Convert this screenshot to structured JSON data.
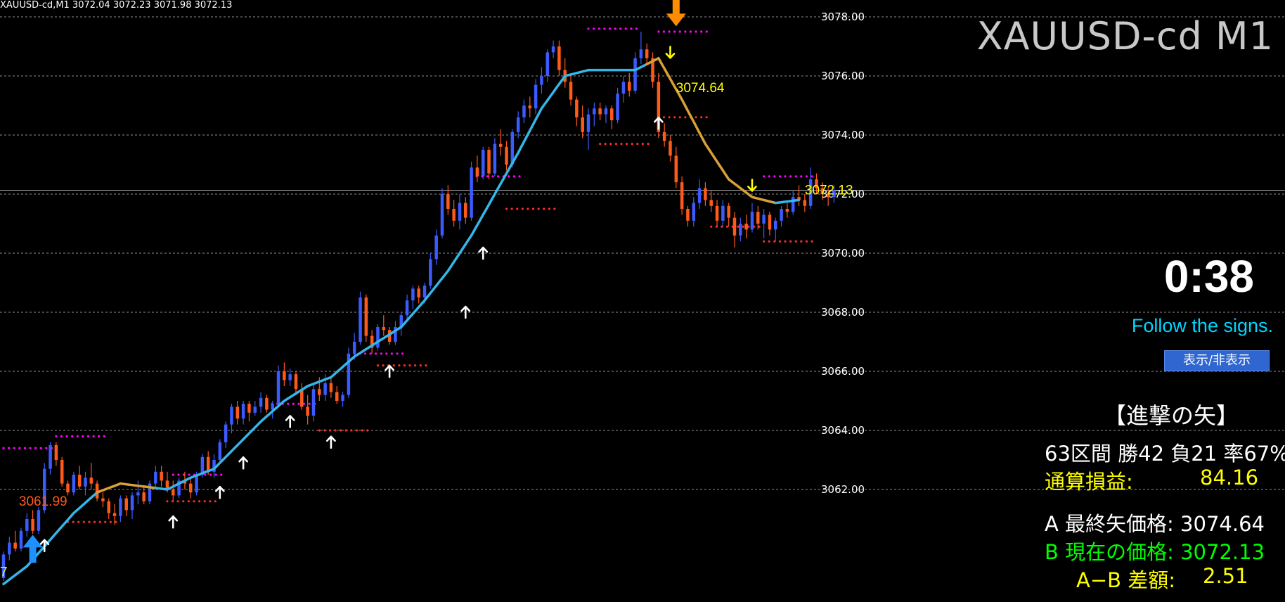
{
  "header": {
    "info": "XAUUSD-cd,M1  3072.04 3072.23 3071.98 3072.13",
    "symbol_title": "XAUUSD-cd M1"
  },
  "panel": {
    "timer": "0:38",
    "tagline": "Follow the signs.",
    "toggle_label": "表示/非表示",
    "title": "【進撃の矢】",
    "summary": "63区間 勝42 負21 率67%",
    "total_pl_label": "通算損益:",
    "total_pl_value": "84.16",
    "last_arrow": "A 最終矢価格: 3074.64",
    "current_price": "B 現在の価格: 3072.13",
    "diff_label": "A−B 差額:",
    "diff_value": "2.51"
  },
  "chart_data": {
    "type": "candlestick",
    "symbol": "XAUUSD-cd",
    "timeframe": "M1",
    "ylim": [
      3058.7,
      3079.2
    ],
    "y_ticks": [
      "3078.00",
      "3076.00",
      "3074.00",
      "3072.00",
      "3070.00",
      "3068.00",
      "3066.00",
      "3064.00",
      "3062.00"
    ],
    "grid": true,
    "colors": {
      "up": "#3b5bff",
      "down": "#ff5a1a",
      "trend_up": "#35b6e8",
      "trend_down": "#d9a036",
      "resistance": "#ff00ff",
      "support": "#ff2a2a",
      "price_label": "#ffff00",
      "grid": "#bfbfbf"
    },
    "candles": [
      [
        3059.0,
        3059.9,
        3058.9,
        3059.8
      ],
      [
        3059.8,
        3060.4,
        3059.6,
        3060.2
      ],
      [
        3060.2,
        3060.6,
        3059.9,
        3060.0
      ],
      [
        3060.0,
        3060.7,
        3059.9,
        3060.6
      ],
      [
        3060.6,
        3061.2,
        3060.4,
        3061.0
      ],
      [
        3061.0,
        3061.3,
        3060.5,
        3060.6
      ],
      [
        3060.6,
        3061.4,
        3060.5,
        3061.3
      ],
      [
        3061.3,
        3062.9,
        3061.2,
        3062.7
      ],
      [
        3062.7,
        3063.6,
        3062.5,
        3063.5
      ],
      [
        3063.5,
        3063.6,
        3062.8,
        3063.0
      ],
      [
        3063.0,
        3063.1,
        3062.1,
        3062.2
      ],
      [
        3062.2,
        3062.3,
        3061.8,
        3061.9
      ],
      [
        3061.9,
        3062.6,
        3061.8,
        3062.5
      ],
      [
        3062.5,
        3062.8,
        3062.0,
        3062.1
      ],
      [
        3062.1,
        3062.6,
        3061.8,
        3062.4
      ],
      [
        3062.4,
        3062.9,
        3062.0,
        3062.2
      ],
      [
        3062.2,
        3062.3,
        3061.6,
        3061.7
      ],
      [
        3061.7,
        3061.9,
        3061.4,
        3061.6
      ],
      [
        3061.6,
        3061.7,
        3061.0,
        3061.2
      ],
      [
        3061.2,
        3061.5,
        3060.8,
        3061.1
      ],
      [
        3061.1,
        3061.8,
        3060.9,
        3061.7
      ],
      [
        3061.7,
        3061.8,
        3061.1,
        3061.3
      ],
      [
        3061.3,
        3061.9,
        3061.0,
        3061.8
      ],
      [
        3061.8,
        3062.3,
        3061.5,
        3061.9
      ],
      [
        3061.9,
        3062.1,
        3061.5,
        3061.6
      ],
      [
        3061.6,
        3062.3,
        3061.5,
        3062.2
      ],
      [
        3062.2,
        3062.8,
        3062.0,
        3062.6
      ],
      [
        3062.6,
        3062.8,
        3062.1,
        3062.3
      ],
      [
        3062.3,
        3062.6,
        3061.9,
        3062.0
      ],
      [
        3062.0,
        3062.3,
        3061.6,
        3061.8
      ],
      [
        3061.8,
        3062.4,
        3061.7,
        3062.3
      ],
      [
        3062.3,
        3062.6,
        3062.0,
        3062.2
      ],
      [
        3062.2,
        3062.4,
        3061.7,
        3061.9
      ],
      [
        3061.9,
        3062.6,
        3061.8,
        3062.5
      ],
      [
        3062.5,
        3063.2,
        3062.4,
        3063.1
      ],
      [
        3063.1,
        3063.3,
        3062.5,
        3062.6
      ],
      [
        3062.6,
        3063.2,
        3062.4,
        3063.0
      ],
      [
        3063.0,
        3063.7,
        3062.9,
        3063.6
      ],
      [
        3063.6,
        3064.3,
        3063.4,
        3064.2
      ],
      [
        3064.2,
        3064.9,
        3063.9,
        3064.8
      ],
      [
        3064.8,
        3065.0,
        3064.2,
        3064.4
      ],
      [
        3064.4,
        3065.0,
        3064.2,
        3064.9
      ],
      [
        3064.9,
        3065.0,
        3064.3,
        3064.6
      ],
      [
        3064.6,
        3065.0,
        3064.5,
        3064.8
      ],
      [
        3064.8,
        3065.3,
        3064.6,
        3065.1
      ],
      [
        3065.1,
        3065.2,
        3064.6,
        3064.7
      ],
      [
        3064.7,
        3065.0,
        3064.4,
        3064.9
      ],
      [
        3064.9,
        3066.2,
        3064.8,
        3066.0
      ],
      [
        3066.0,
        3066.3,
        3065.5,
        3065.7
      ],
      [
        3065.7,
        3066.1,
        3065.5,
        3065.9
      ],
      [
        3065.9,
        3066.0,
        3065.2,
        3065.4
      ],
      [
        3065.4,
        3065.6,
        3064.7,
        3064.8
      ],
      [
        3064.8,
        3065.2,
        3064.2,
        3064.5
      ],
      [
        3064.5,
        3065.6,
        3064.3,
        3065.4
      ],
      [
        3065.4,
        3065.8,
        3065.0,
        3065.2
      ],
      [
        3065.2,
        3065.9,
        3065.0,
        3065.6
      ],
      [
        3065.6,
        3065.8,
        3065.1,
        3065.3
      ],
      [
        3065.3,
        3065.5,
        3064.9,
        3065.0
      ],
      [
        3065.0,
        3065.3,
        3064.8,
        3065.2
      ],
      [
        3065.2,
        3066.8,
        3065.1,
        3066.6
      ],
      [
        3066.6,
        3067.3,
        3066.4,
        3067.0
      ],
      [
        3067.0,
        3068.7,
        3066.9,
        3068.5
      ],
      [
        3068.5,
        3068.6,
        3067.0,
        3067.2
      ],
      [
        3067.2,
        3067.4,
        3066.6,
        3066.8
      ],
      [
        3066.8,
        3067.6,
        3066.7,
        3067.5
      ],
      [
        3067.5,
        3067.9,
        3067.2,
        3067.4
      ],
      [
        3067.4,
        3067.5,
        3066.9,
        3067.0
      ],
      [
        3067.0,
        3067.7,
        3066.9,
        3067.5
      ],
      [
        3067.5,
        3068.0,
        3067.2,
        3067.9
      ],
      [
        3067.9,
        3068.6,
        3067.7,
        3068.4
      ],
      [
        3068.4,
        3068.9,
        3068.1,
        3068.8
      ],
      [
        3068.8,
        3068.9,
        3068.3,
        3068.5
      ],
      [
        3068.5,
        3069.0,
        3068.3,
        3068.9
      ],
      [
        3068.9,
        3070.0,
        3068.8,
        3069.8
      ],
      [
        3069.8,
        3070.8,
        3069.6,
        3070.6
      ],
      [
        3070.6,
        3072.2,
        3070.5,
        3072.0
      ],
      [
        3072.0,
        3072.3,
        3071.3,
        3071.5
      ],
      [
        3071.5,
        3071.8,
        3070.9,
        3071.1
      ],
      [
        3071.1,
        3072.0,
        3070.8,
        3071.7
      ],
      [
        3071.7,
        3071.9,
        3071.0,
        3071.2
      ],
      [
        3071.2,
        3073.1,
        3071.1,
        3072.9
      ],
      [
        3072.9,
        3073.3,
        3072.4,
        3072.6
      ],
      [
        3072.6,
        3073.6,
        3072.5,
        3073.5
      ],
      [
        3073.5,
        3073.6,
        3072.5,
        3072.7
      ],
      [
        3072.7,
        3073.9,
        3072.6,
        3073.7
      ],
      [
        3073.7,
        3074.2,
        3073.3,
        3073.6
      ],
      [
        3073.6,
        3073.8,
        3072.8,
        3073.0
      ],
      [
        3073.0,
        3074.2,
        3072.9,
        3074.1
      ],
      [
        3074.1,
        3074.8,
        3073.9,
        3074.6
      ],
      [
        3074.6,
        3075.2,
        3074.4,
        3075.0
      ],
      [
        3075.0,
        3075.3,
        3074.6,
        3074.9
      ],
      [
        3074.9,
        3075.9,
        3074.7,
        3075.7
      ],
      [
        3075.7,
        3076.3,
        3075.4,
        3076.0
      ],
      [
        3076.0,
        3076.9,
        3075.8,
        3076.8
      ],
      [
        3076.8,
        3077.2,
        3076.6,
        3077.0
      ],
      [
        3077.0,
        3077.2,
        3076.0,
        3076.2
      ],
      [
        3076.2,
        3076.6,
        3075.6,
        3075.8
      ],
      [
        3075.8,
        3076.0,
        3075.0,
        3075.2
      ],
      [
        3075.2,
        3075.3,
        3074.3,
        3074.6
      ],
      [
        3074.6,
        3075.0,
        3073.9,
        3074.1
      ],
      [
        3074.1,
        3074.9,
        3073.5,
        3074.7
      ],
      [
        3074.7,
        3075.1,
        3074.3,
        3074.9
      ],
      [
        3074.9,
        3075.1,
        3074.5,
        3074.7
      ],
      [
        3074.7,
        3075.0,
        3074.4,
        3074.9
      ],
      [
        3074.9,
        3075.0,
        3074.2,
        3074.5
      ],
      [
        3074.5,
        3075.6,
        3074.4,
        3075.4
      ],
      [
        3075.4,
        3076.0,
        3075.1,
        3075.8
      ],
      [
        3075.8,
        3076.1,
        3075.3,
        3075.5
      ],
      [
        3075.5,
        3076.8,
        3075.4,
        3076.6
      ],
      [
        3076.6,
        3077.5,
        3076.4,
        3076.9
      ],
      [
        3076.9,
        3077.1,
        3076.4,
        3076.6
      ],
      [
        3076.6,
        3076.8,
        3075.6,
        3075.8
      ],
      [
        3075.8,
        3076.1,
        3073.9,
        3074.1
      ],
      [
        3074.1,
        3074.4,
        3073.6,
        3073.8
      ],
      [
        3073.8,
        3074.0,
        3073.1,
        3073.3
      ],
      [
        3073.3,
        3073.6,
        3072.2,
        3072.4
      ],
      [
        3072.4,
        3072.6,
        3071.3,
        3071.5
      ],
      [
        3071.5,
        3071.6,
        3070.9,
        3071.1
      ],
      [
        3071.1,
        3071.9,
        3070.9,
        3071.7
      ],
      [
        3071.7,
        3072.5,
        3071.5,
        3072.2
      ],
      [
        3072.2,
        3072.4,
        3071.6,
        3071.8
      ],
      [
        3071.8,
        3072.1,
        3071.4,
        3071.6
      ],
      [
        3071.6,
        3071.8,
        3070.9,
        3071.1
      ],
      [
        3071.1,
        3071.8,
        3070.9,
        3071.6
      ],
      [
        3071.6,
        3071.7,
        3070.9,
        3071.2
      ],
      [
        3071.2,
        3071.4,
        3070.2,
        3070.6
      ],
      [
        3070.6,
        3071.2,
        3070.4,
        3071.0
      ],
      [
        3071.0,
        3071.3,
        3070.5,
        3070.8
      ],
      [
        3070.8,
        3071.7,
        3070.7,
        3071.4
      ],
      [
        3071.4,
        3071.6,
        3070.8,
        3071.0
      ],
      [
        3071.0,
        3071.5,
        3070.5,
        3071.3
      ],
      [
        3071.3,
        3071.4,
        3070.6,
        3070.8
      ],
      [
        3070.8,
        3071.2,
        3070.4,
        3071.1
      ],
      [
        3071.1,
        3071.6,
        3070.9,
        3071.5
      ],
      [
        3071.5,
        3071.7,
        3071.2,
        3071.4
      ],
      [
        3071.4,
        3072.1,
        3071.3,
        3071.9
      ],
      [
        3071.9,
        3072.3,
        3071.6,
        3071.8
      ],
      [
        3071.8,
        3072.0,
        3071.4,
        3071.6
      ],
      [
        3071.6,
        3072.9,
        3071.5,
        3072.5
      ],
      [
        3072.5,
        3072.7,
        3072.0,
        3072.2
      ],
      [
        3072.2,
        3072.4,
        3071.8,
        3072.0
      ],
      [
        3072.0,
        3072.2,
        3071.6,
        3071.9
      ],
      [
        3071.9,
        3072.3,
        3071.7,
        3072.13
      ]
    ],
    "trend_line": [
      [
        0,
        3058.8
      ],
      [
        4,
        3059.4
      ],
      [
        8,
        3060.3
      ],
      [
        12,
        3061.2
      ],
      [
        16,
        3061.9
      ],
      [
        20,
        3062.2
      ],
      [
        24,
        3062.1
      ],
      [
        28,
        3062.0
      ],
      [
        32,
        3062.4
      ],
      [
        36,
        3062.7
      ],
      [
        40,
        3063.5
      ],
      [
        44,
        3064.3
      ],
      [
        48,
        3065.0
      ],
      [
        52,
        3065.5
      ],
      [
        56,
        3065.8
      ],
      [
        60,
        3066.5
      ],
      [
        64,
        3067.0
      ],
      [
        68,
        3067.5
      ],
      [
        72,
        3068.4
      ],
      [
        76,
        3069.4
      ],
      [
        80,
        3070.6
      ],
      [
        84,
        3072.0
      ],
      [
        88,
        3073.4
      ],
      [
        92,
        3074.9
      ],
      [
        96,
        3076.0
      ],
      [
        100,
        3076.2
      ],
      [
        104,
        3076.2
      ],
      [
        108,
        3076.2
      ],
      [
        112,
        3076.6
      ],
      [
        116,
        3075.2
      ],
      [
        120,
        3073.7
      ],
      [
        124,
        3072.5
      ],
      [
        128,
        3071.9
      ],
      [
        132,
        3071.7
      ],
      [
        136,
        3071.8
      ]
    ],
    "trend_direction": [
      [
        0,
        16,
        "up"
      ],
      [
        16,
        26,
        "down"
      ],
      [
        26,
        110,
        "up"
      ],
      [
        110,
        132,
        "down"
      ],
      [
        132,
        136,
        "up"
      ]
    ],
    "resistance_dotted": [
      [
        0,
        3063.4
      ],
      [
        9,
        3063.8
      ],
      [
        29,
        3062.5
      ],
      [
        45,
        3064.9
      ],
      [
        60,
        3066.6
      ],
      [
        80,
        3072.6
      ],
      [
        100,
        3077.6
      ],
      [
        112,
        3077.5
      ],
      [
        130,
        3072.6
      ]
    ],
    "support_dotted": [
      [
        11,
        3060.9
      ],
      [
        28,
        3061.6
      ],
      [
        54,
        3064.0
      ],
      [
        64,
        3066.2
      ],
      [
        86,
        3071.5
      ],
      [
        102,
        3073.7
      ],
      [
        112,
        3074.6
      ],
      [
        121,
        3070.9
      ],
      [
        130,
        3070.4
      ]
    ],
    "up_arrows": [
      [
        7,
        3060.1
      ],
      [
        29,
        3060.9
      ],
      [
        37,
        3061.9
      ],
      [
        41,
        3062.9
      ],
      [
        49,
        3064.3
      ],
      [
        56,
        3063.6
      ],
      [
        66,
        3066.0
      ],
      [
        79,
        3068.0
      ],
      [
        82,
        3070.0
      ],
      [
        112,
        3074.4
      ]
    ],
    "down_arrows": [
      [
        114,
        3076.8
      ],
      [
        128,
        3072.3
      ]
    ],
    "big_up_arrow": [
      5,
      3059.8
    ],
    "big_down_arrow": [
      115,
      3078.3
    ],
    "labels": [
      {
        "text": "3061.99",
        "x": 6,
        "y": 3061.6,
        "color": "#ff5a1a"
      },
      {
        "text": "3074.64",
        "x": 115,
        "y": 3075.6,
        "color": "#ffff00"
      },
      {
        "text": "3072.13",
        "x": 137,
        "y": 3072.13,
        "color": "#ffff00"
      },
      {
        "text": "7",
        "x": 0,
        "y": 3059.2,
        "color": "#ffff00"
      }
    ]
  }
}
